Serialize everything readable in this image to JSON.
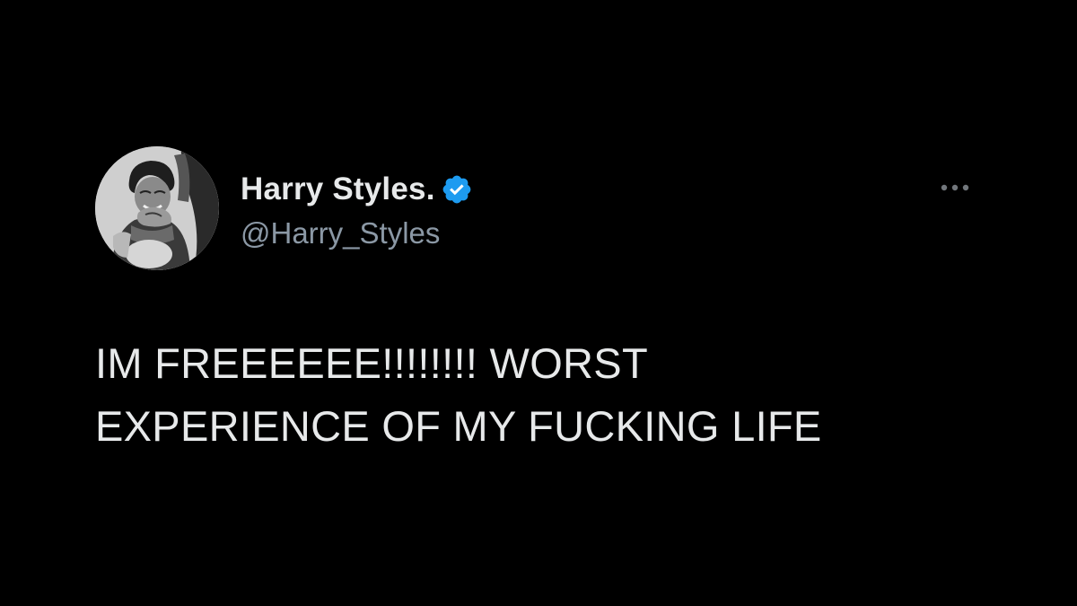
{
  "tweet": {
    "author": {
      "display_name": "Harry Styles.",
      "handle": "@Harry_Styles",
      "avatar_icon": "profile-photo",
      "verified_icon": "verified-badge-icon",
      "verified_color": "#1d9bf0"
    },
    "more_icon": "more-options-icon",
    "text_lines": [
      "IM FREEEEEE!!!!!!!! WORST",
      "EXPERIENCE OF MY FUCKING LIFE"
    ]
  },
  "colors": {
    "background": "#000000",
    "primary_text": "#e7e9ea",
    "secondary_text": "#8b98a5"
  }
}
